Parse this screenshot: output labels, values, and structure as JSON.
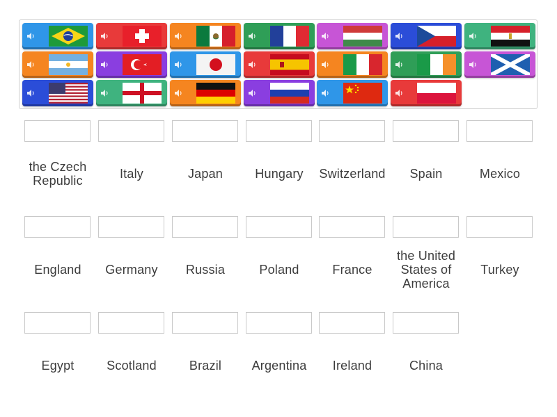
{
  "colors": {
    "blue": "#2f96e8",
    "red": "#e83a3a",
    "orange": "#f58520",
    "green": "#2f9e57",
    "magenta": "#c755d6",
    "navy": "#2b4dd8",
    "teal": "#3fb37f",
    "purple": "#8a3ee0"
  },
  "tiles": [
    {
      "flag": "brazil-flag",
      "color": "blue"
    },
    {
      "flag": "switzerland-flag",
      "color": "red"
    },
    {
      "flag": "mexico-flag",
      "color": "orange"
    },
    {
      "flag": "france-flag",
      "color": "green"
    },
    {
      "flag": "hungary-flag",
      "color": "magenta"
    },
    {
      "flag": "czech-flag",
      "color": "navy"
    },
    {
      "flag": "egypt-flag",
      "color": "teal"
    },
    {
      "flag": "argentina-flag",
      "color": "orange"
    },
    {
      "flag": "turkey-flag",
      "color": "purple"
    },
    {
      "flag": "japan-flag",
      "color": "blue"
    },
    {
      "flag": "spain-flag",
      "color": "red"
    },
    {
      "flag": "italy-flag",
      "color": "orange"
    },
    {
      "flag": "ireland-flag",
      "color": "green"
    },
    {
      "flag": "scotland-flag",
      "color": "magenta"
    },
    {
      "flag": "usa-flag",
      "color": "navy"
    },
    {
      "flag": "england-flag",
      "color": "teal"
    },
    {
      "flag": "germany-flag",
      "color": "orange"
    },
    {
      "flag": "russia-flag",
      "color": "purple"
    },
    {
      "flag": "china-flag",
      "color": "blue"
    },
    {
      "flag": "poland-flag",
      "color": "red"
    }
  ],
  "labels": [
    "the Czech Republic",
    "Italy",
    "Japan",
    "Hungary",
    "Switzerland",
    "Spain",
    "Mexico",
    "England",
    "Germany",
    "Russia",
    "Poland",
    "France",
    "the United States of America",
    "Turkey",
    "Egypt",
    "Scotland",
    "Brazil",
    "Argentina",
    "Ireland",
    "China"
  ]
}
